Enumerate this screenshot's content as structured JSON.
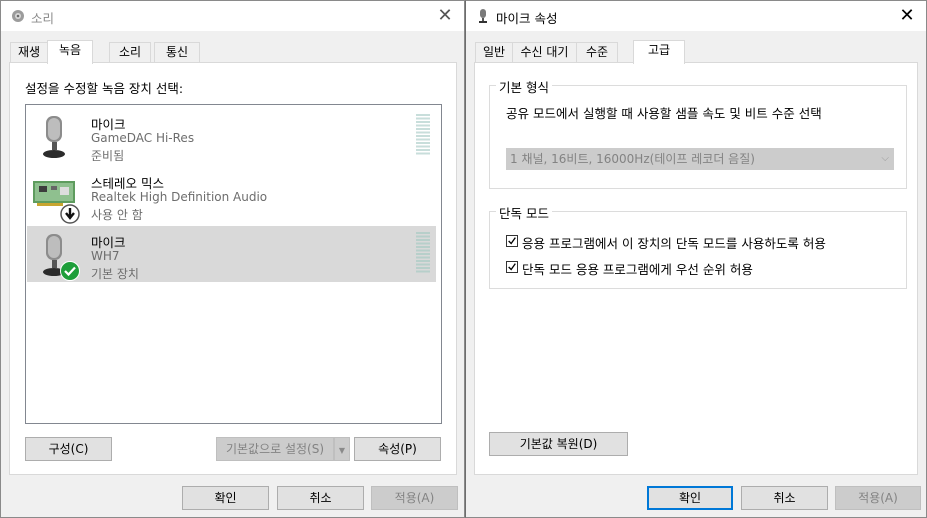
{
  "sound_window": {
    "title": "소리",
    "tabs": [
      "재생",
      "녹음",
      "소리",
      "통신"
    ],
    "active_tab": "녹음",
    "instruction": "설정을 수정할 녹음 장치 선택:",
    "devices": [
      {
        "name": "마이크",
        "detail": "GameDAC Hi-Res",
        "status": "준비됨",
        "icon": "microphone-icon",
        "badge": "",
        "selected": false
      },
      {
        "name": "스테레오 믹스",
        "detail": "Realtek High Definition Audio",
        "status": "사용 안 함",
        "icon": "sound-card-icon",
        "badge": "down-arrow-badge-icon",
        "selected": false
      },
      {
        "name": "마이크",
        "detail": "WH7",
        "status": "기본 장치",
        "icon": "microphone-icon",
        "badge": "green-check-badge-icon",
        "selected": true
      }
    ],
    "buttons": {
      "configure": "구성(C)",
      "set_default": "기본값으로 설정(S)",
      "properties": "속성(P)",
      "ok": "확인",
      "cancel": "취소",
      "apply": "적용(A)"
    }
  },
  "mic_props_window": {
    "title": "마이크 속성",
    "tabs": [
      "일반",
      "수신 대기",
      "수준",
      "고급"
    ],
    "active_tab": "고급",
    "default_format": {
      "label": "기본 형식",
      "description": "공유 모드에서 실행할 때 사용할 샘플 속도 및 비트 수준 선택",
      "selected_value": "1 채널, 16비트, 16000Hz(테이프 레코더 음질)"
    },
    "exclusive_mode": {
      "label": "단독 모드",
      "options": [
        {
          "label": "응용 프로그램에서 이 장치의 단독 모드를 사용하도록 허용",
          "checked": true
        },
        {
          "label": "단독 모드 응용 프로그램에게 우선 순위 허용",
          "checked": true
        }
      ]
    },
    "buttons": {
      "restore_defaults": "기본값 복원(D)",
      "ok": "확인",
      "cancel": "취소",
      "apply": "적용(A)"
    }
  },
  "colors": {
    "accent": "#0078d7",
    "selection": "#d9d9d9",
    "check_green": "#1e9e3a"
  }
}
